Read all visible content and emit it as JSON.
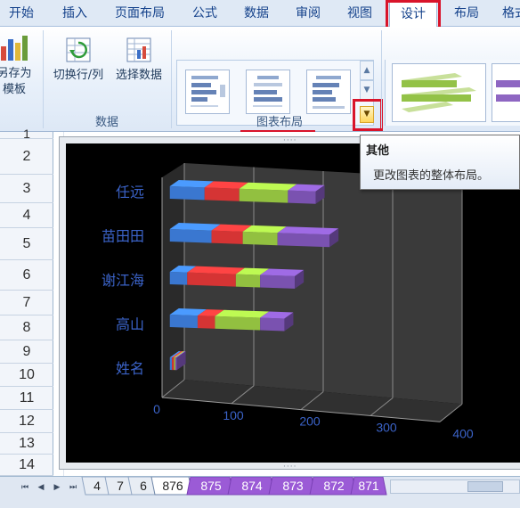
{
  "ribbon_tabs": [
    {
      "label": "开始"
    },
    {
      "label": "插入"
    },
    {
      "label": "页面布局"
    },
    {
      "label": "公式"
    },
    {
      "label": "数据"
    },
    {
      "label": "审阅"
    },
    {
      "label": "视图"
    },
    {
      "label": "设计",
      "active": true
    },
    {
      "label": "布局"
    },
    {
      "label": "格式"
    }
  ],
  "ribbon": {
    "save_template_label_1": "另存为",
    "save_template_label_2": "模板",
    "switch_row_col_label": "切换行/列",
    "select_data_label": "选择数据",
    "data_group_label": "数据",
    "chart_layouts_group_label": "图表布局"
  },
  "tooltip": {
    "title": "其他",
    "description": "更改图表的整体布局。"
  },
  "sheet": {
    "row_numbers": [
      "1",
      "2",
      "3",
      "4",
      "5",
      "6",
      "7",
      "8",
      "9",
      "10",
      "11",
      "12",
      "13",
      "14"
    ]
  },
  "sheet_tabs": [
    {
      "label": "4"
    },
    {
      "label": "7"
    },
    {
      "label": "6"
    },
    {
      "label": "876",
      "active": true
    },
    {
      "label": "875"
    },
    {
      "label": "874"
    },
    {
      "label": "873"
    },
    {
      "label": "872"
    },
    {
      "label": "871"
    }
  ],
  "colors": {
    "accent_red": "#d9142a",
    "series_blue": "#3a77d0",
    "series_red": "#d53434",
    "series_green": "#92c040",
    "series_purple": "#7a52b0",
    "axis_label_blue": "#3b63c8",
    "sheet_tab_purple": "#9b5bd6"
  },
  "chart_data": {
    "type": "bar",
    "orientation": "horizontal",
    "stacked": true,
    "3d": true,
    "categories": [
      "任远",
      "苗田田",
      "谢江海",
      "高山",
      "姓名"
    ],
    "series": [
      {
        "values": [
          50,
          60,
          25,
          40,
          3
        ]
      },
      {
        "values": [
          50,
          45,
          70,
          25,
          3
        ]
      },
      {
        "values": [
          70,
          50,
          35,
          65,
          2
        ]
      },
      {
        "values": [
          40,
          75,
          50,
          35,
          2
        ]
      }
    ],
    "x_ticks": [
      "0",
      "100",
      "200",
      "300",
      "400"
    ],
    "xlim": [
      0,
      400
    ],
    "grid": true,
    "legend": "none"
  }
}
